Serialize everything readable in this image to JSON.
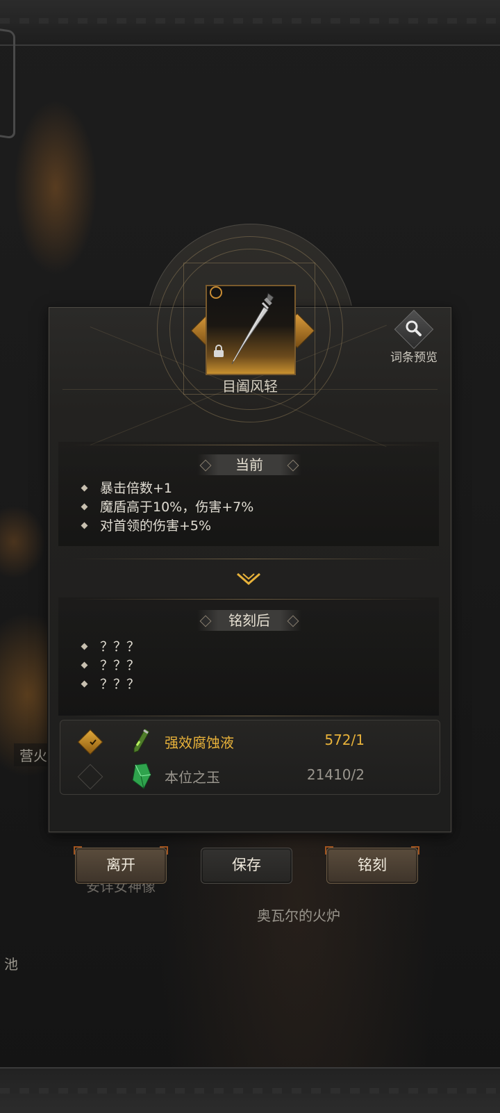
{
  "background": {
    "labels": {
      "campfire": "营火",
      "goddess": "安详女神像",
      "forge": "奥瓦尔的火炉",
      "pool": "池"
    }
  },
  "item": {
    "name": "目阖风轻",
    "locked": true
  },
  "preview": {
    "label": "词条预览",
    "icon": "magnifier-icon"
  },
  "current": {
    "title": "当前",
    "stats": [
      "暴击倍数+1",
      "魔盾高于10%，伤害+7%",
      "对首领的伤害+5%"
    ]
  },
  "after": {
    "title": "铭刻后",
    "stats": [
      "？？？",
      "？？？",
      "？？？"
    ]
  },
  "materials": [
    {
      "name": "强效腐蚀液",
      "count": "572/1",
      "selected": true,
      "icon": "potion-vial-icon"
    },
    {
      "name": "本位之玉",
      "count": "21410/2",
      "selected": false,
      "icon": "green-gem-icon"
    }
  ],
  "buttons": {
    "leave": "离开",
    "save": "保存",
    "inscribe": "铭刻"
  },
  "colors": {
    "accent_gold": "#e8b23a",
    "panel": "#232220",
    "button_brown": "#5a4c3c"
  }
}
